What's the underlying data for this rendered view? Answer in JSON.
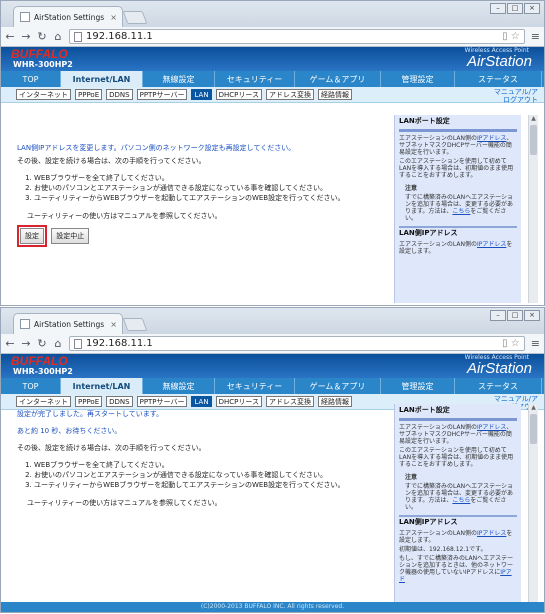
{
  "browser": {
    "tab_title": "AirStation Settings",
    "url": "192.168.11.1"
  },
  "header": {
    "brand": "BUFFALO",
    "model": "WHR-300HP2",
    "tagline": "Wireless Access Point",
    "product": "AirStation"
  },
  "main_nav": [
    "TOP",
    "Internet/LAN",
    "無線設定",
    "セキュリティー",
    "ゲーム＆アプリ",
    "管理設定",
    "ステータス"
  ],
  "sub_nav": [
    "インターネット",
    "PPPoE",
    "DDNS",
    "PPTPサーバー",
    "LAN",
    "DHCPリース",
    "アドレス変換",
    "経路情報"
  ],
  "header_links": [
    "マニュアル/ア",
    "ログアウト"
  ],
  "screen1": {
    "msg1": "LAN側IPアドレスを変更します。パソコン側のネットワーク設定も再設定してください。",
    "msg2": "その後、設定を続ける場合は、次の手順を行ってください。",
    "steps": [
      "WEBブラウザーを全て終了してください。",
      "お使いのパソコンとエアステーションが通信できる設定になっている事を確認してください。",
      "ユーティリティーからWEBブラウザーを起動してエアステーションのWEB設定を行ってください。"
    ],
    "msg3": "ユーティリティーの使い方はマニュアルを参照してください。",
    "btn_set": "設定",
    "btn_cancel": "設定中止"
  },
  "screen2": {
    "msg1": "設定が完了しました。再スタートしています。",
    "msg2": "あと約 10 秒、お待ちください。",
    "msg3": "その後、設定を続ける場合は、次の手順を行ってください。",
    "steps": [
      "WEBブラウザーを全て終了してください。",
      "お使いのパソコンとエアステーションが通信できる設定になっている事を確認してください。",
      "ユーティリティーからWEBブラウザーを起動してエアステーションのWEB設定を行ってください。"
    ],
    "msg4": "ユーティリティーの使い方はマニュアルを参照してください。",
    "footer": "(C)2000-2013 BUFFALO INC. All rights reserved."
  },
  "sidebar": {
    "title": "LANポート設定",
    "p1a": "エアステーションのLAN側の",
    "p1link": "IPアドレス",
    "p1b": "、サブネットマスクDHCPサーバー機能の簡易設定を行います。",
    "p2": "このエアステーションを使用して初めてLANを導入する場合は、初期値のまま使用することをおすすめします。",
    "note_title": "注意",
    "note": "すでに構築済みのLANへエアステーションを追加する場合は、変更する必要があります。方法は、",
    "note_link": "こちら",
    "note_end": "をご覧ください。",
    "sec2_title": "LAN側IPアドレス",
    "sec2_p1a": "エアステーションのLAN側の",
    "sec2_link": "IPアドレス",
    "sec2_p1b": "を設定します。",
    "sec2_p2": "初期値は、192.168.12.1です。",
    "sec2_p3": "もし、すでに構築済みのLANへエアステーションを追加するときは、他のネットワーク機器の使用していないIPアドレスに",
    "sec2_link2": "IPアド"
  }
}
